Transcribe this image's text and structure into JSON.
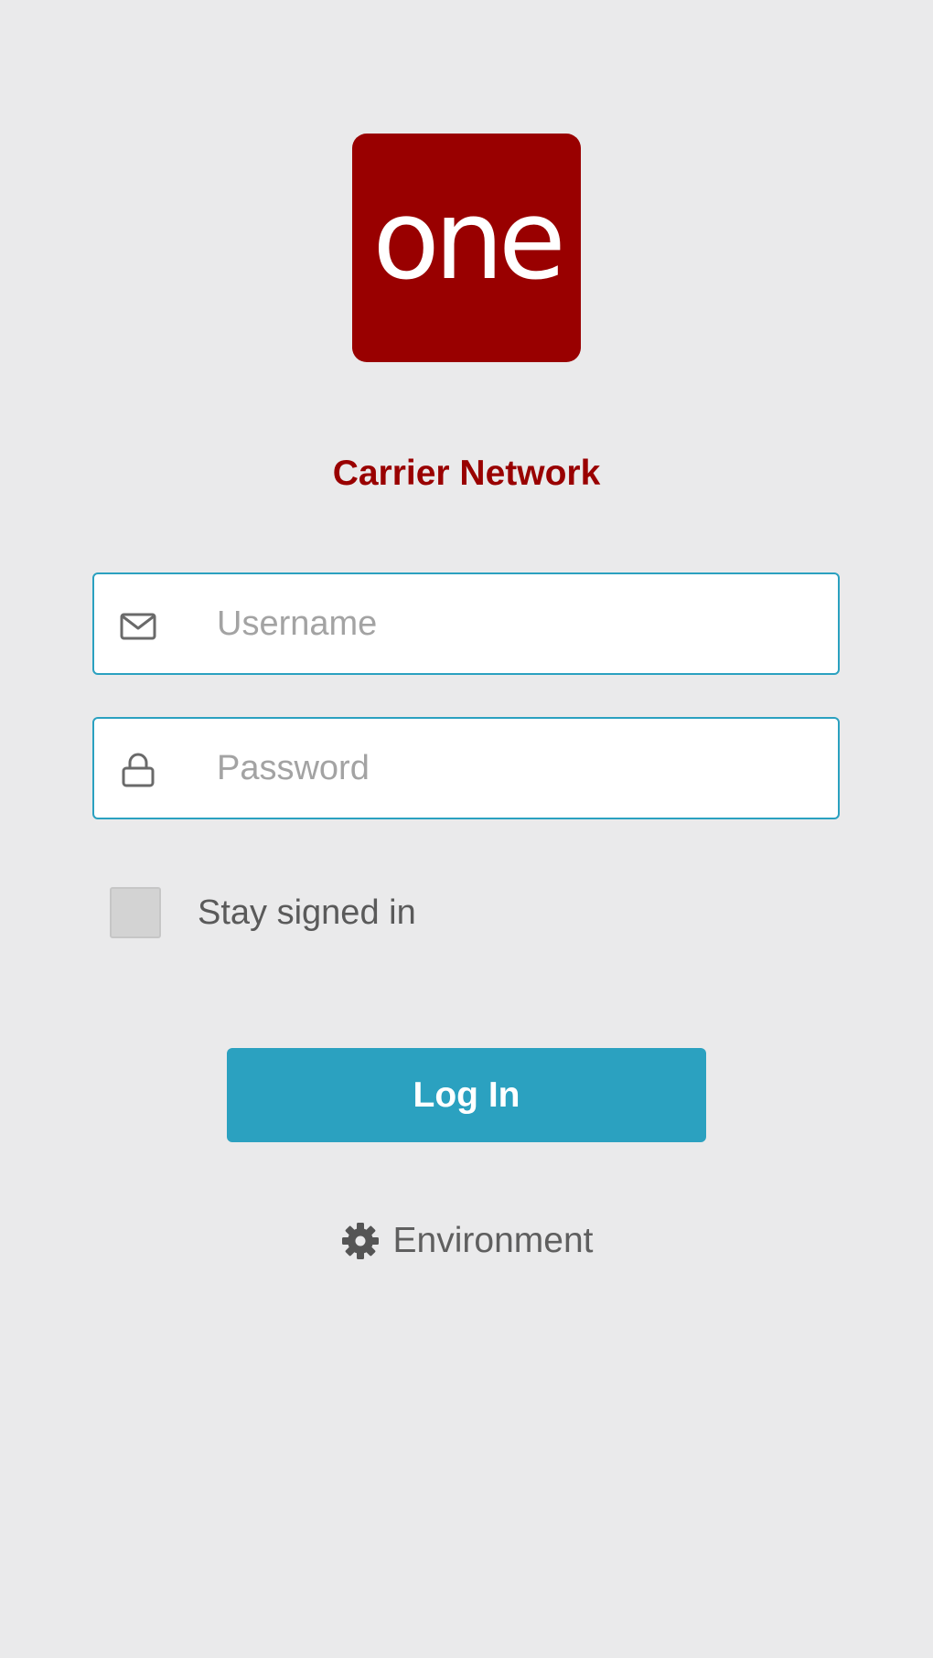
{
  "logo": {
    "text": "one",
    "background": "#990000"
  },
  "app_title": "Carrier Network",
  "form": {
    "username_placeholder": "Username",
    "username_value": "",
    "username_icon": "envelope-icon",
    "password_placeholder": "Password",
    "password_value": "",
    "password_icon": "lock-icon",
    "stay_signed_in_label": "Stay signed in",
    "stay_signed_in_checked": false,
    "login_label": "Log In"
  },
  "environment": {
    "label": "Environment",
    "icon": "gear-icon"
  },
  "colors": {
    "brand": "#990000",
    "accent": "#2ba1c0",
    "background": "#eaeaeb"
  }
}
